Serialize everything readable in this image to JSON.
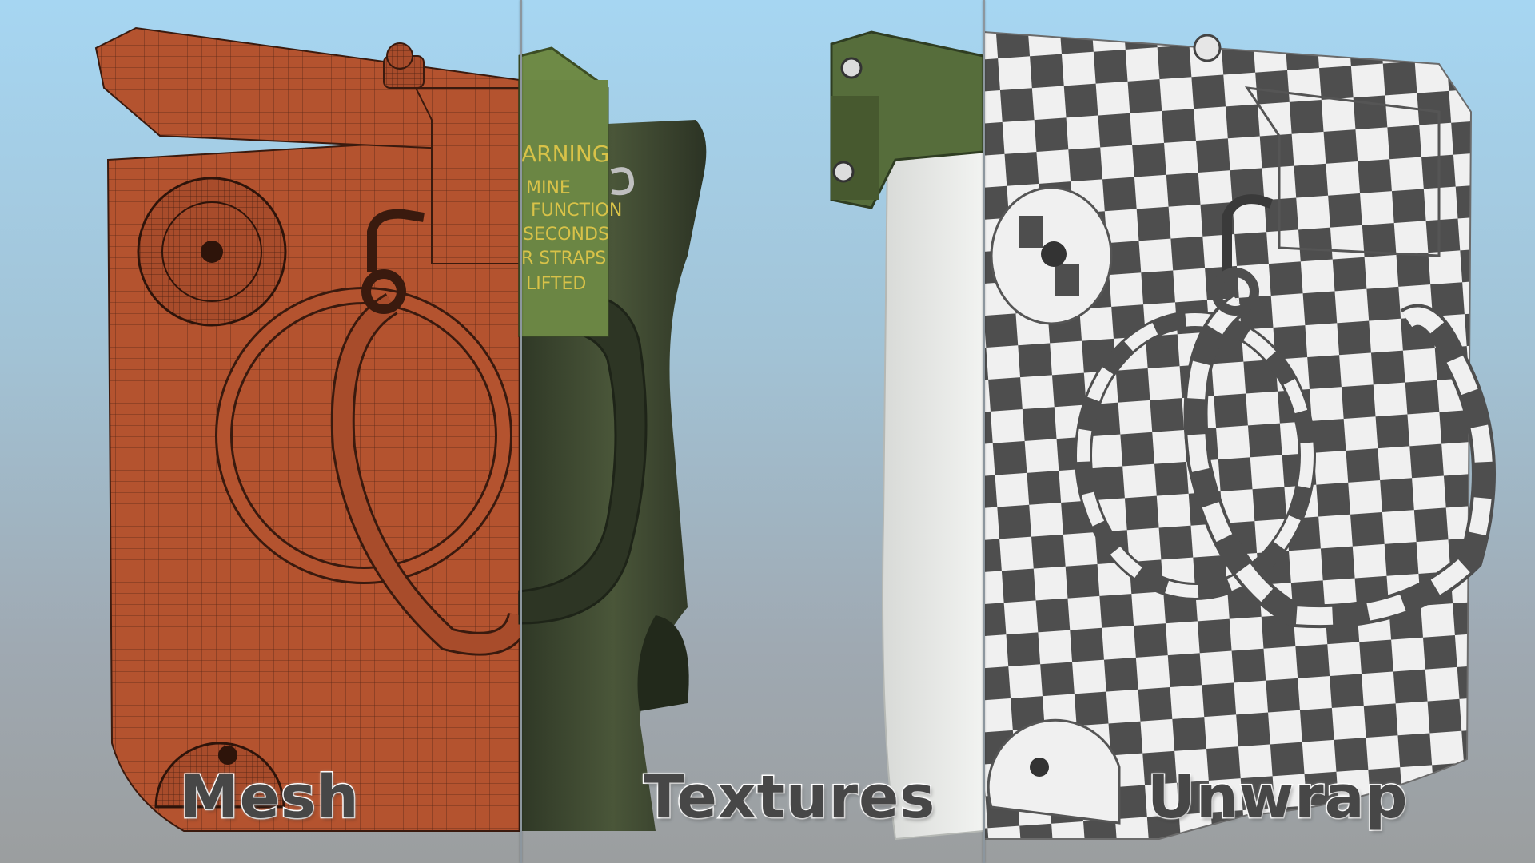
{
  "captions": {
    "mesh": "Mesh",
    "textures": "Textures",
    "unwrap": "Unwrap"
  },
  "warning_label": {
    "line1": "ARNING",
    "line2": "MINE",
    "line3": "FUNCTION",
    "line4": "SECONDS",
    "line5": "R STRAPS",
    "line6": "LIFTED"
  },
  "colors": {
    "background_top": "#a6d6f2",
    "background_bottom": "#9b9e9f",
    "mesh_orange": "#b4532f",
    "texture_green": "#3f4a33",
    "label_green": "#6e8a46",
    "warning_yellow": "#d8c248",
    "checker_dark": "#4e4e4e",
    "checker_light": "#f0f0f0"
  }
}
